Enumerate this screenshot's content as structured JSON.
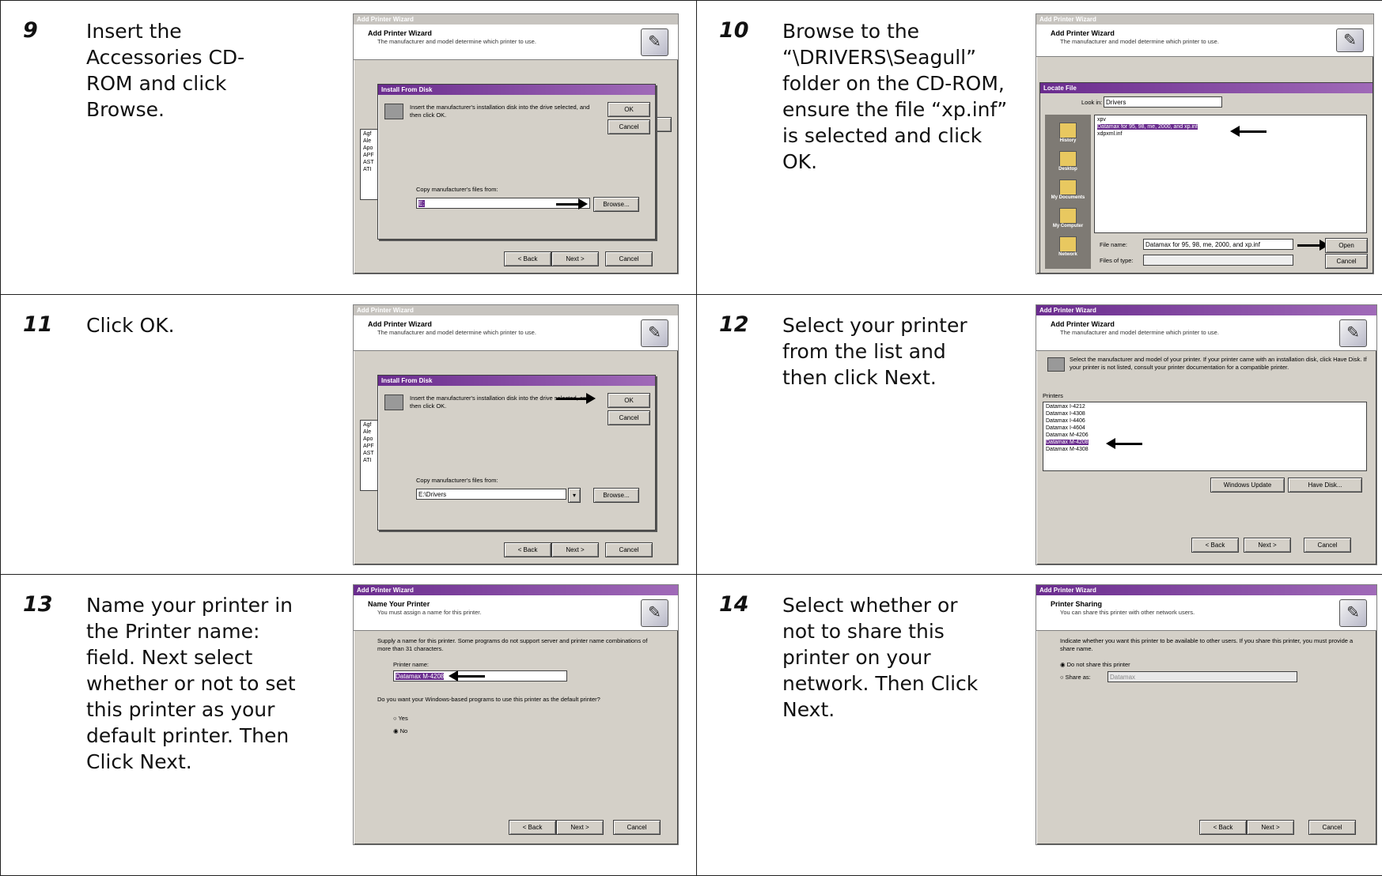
{
  "steps": [
    {
      "num": "9",
      "text": "Insert the Accessories CD-ROM and click Browse."
    },
    {
      "num": "10",
      "text": "Browse to the “\\DRIVERS\\Seagull” folder on the CD-ROM, ensure the file “xp.inf” is selected and click OK."
    },
    {
      "num": "11",
      "text": "Click OK."
    },
    {
      "num": "12",
      "text": "Select your printer from the list and then click Next."
    },
    {
      "num": "13",
      "text": "Name your printer in the Printer name: field.  Next select whether or not to set this printer as your default printer. Then Click Next."
    },
    {
      "num": "14",
      "text": "Select whether or not to share this printer on your network. Then Click Next."
    }
  ],
  "dialogs": {
    "wizard_title": "Add Printer Wizard",
    "wizard_header": "Add Printer Wizard",
    "wizard_sub": "The manufacturer and model determine which printer to use.",
    "install_title": "Install From Disk",
    "install_msg": "Insert the manufacturer's installation disk into the drive selected, and then click OK.",
    "copy_label": "Copy manufacturer's files from:",
    "path_value": "E:\\Drivers",
    "ok": "OK",
    "cancel": "Cancel",
    "browse": "Browse...",
    "back": "< Back",
    "next": "Next >",
    "locate_title": "Locate File",
    "look_in": "Look in:",
    "folder": "Drivers",
    "files": [
      "Datamax for 95, 98, me, 2000, and xp.inf",
      "xdpxml.inf"
    ],
    "file_name_label": "File name:",
    "file_name_value": "Datamax for 95, 98, me, 2000, and xp.inf",
    "files_type_label": "Files of type:",
    "open": "Open",
    "places": [
      "History",
      "Desktop",
      "My Documents",
      "My Computer",
      "Network"
    ],
    "select_msg": "Select the manufacturer and model of your printer. If your printer came with an installation disk, click Have Disk. If your printer is not listed, consult your printer documentation for a compatible printer.",
    "printers_label": "Printers",
    "printers": [
      "Datamax I-4212",
      "Datamax I-4308",
      "Datamax I-4406",
      "Datamax I-4604",
      "Datamax M-4206",
      "Datamax M-4208",
      "Datamax M-4308"
    ],
    "windows_update": "Windows Update",
    "have_disk": "Have Disk...",
    "name_header": "Name Your Printer",
    "name_sub": "You must assign a name for this printer.",
    "name_msg": "Supply a name for this printer. Some programs do not support server and printer name combinations of more than 31 characters.",
    "printer_name_label": "Printer name:",
    "printer_name_value": "Datamax M-4208",
    "default_q": "Do you want your Windows-based programs to use this printer as the default printer?",
    "yes": "Yes",
    "no": "No",
    "share_header": "Printer Sharing",
    "share_sub": "You can share this printer with other network users.",
    "share_msg": "Indicate whether you want this printer to be available to other users. If you share this printer, you must provide a share name.",
    "no_share": "Do not share this printer",
    "share_as": "Share as:",
    "share_value": "Datamax"
  }
}
